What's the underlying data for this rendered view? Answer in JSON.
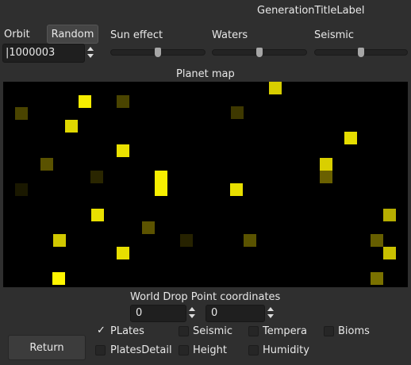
{
  "title": "GenerationTitleLabel",
  "orbit": {
    "label": "Orbit",
    "random_label": "Random",
    "value": "|1000003"
  },
  "sliders": [
    {
      "label": "Sun effect",
      "value": 0.5
    },
    {
      "label": "Waters",
      "value": 0.5
    },
    {
      "label": "Seismic",
      "value": 0.5
    }
  ],
  "map": {
    "label": "Planet map",
    "cells": [
      {
        "c": "#f5ec00"
      },
      {
        "c": "#4a4400"
      },
      {
        "c": "#4a4400"
      },
      {
        "c": "#e0d800"
      },
      {
        "c": "#3e3800"
      },
      {
        "c": "#d7cd00"
      },
      {
        "c": "#e6dd00"
      },
      {
        "c": "#5a5200"
      },
      {
        "c": "#eae100"
      },
      {
        "c": "#2a2600"
      },
      {
        "c": "#f7ef00"
      },
      {
        "c": "#e8df00"
      },
      {
        "c": "#d9cf00"
      },
      {
        "c": "#6a6000"
      },
      {
        "c": "#1a1800"
      },
      {
        "c": "#e9e000"
      },
      {
        "c": "#5c5300"
      },
      {
        "c": "#262200"
      },
      {
        "c": "#5a5300"
      },
      {
        "c": "#b6ad00"
      },
      {
        "c": "#d1c800"
      },
      {
        "c": "#665e00"
      },
      {
        "c": "#e7de00"
      },
      {
        "c": "#c9c000"
      },
      {
        "c": "#7a7100"
      },
      {
        "c": "#fff600"
      },
      {
        "c": "#ded500"
      },
      {
        "c": "#7f7400"
      },
      {
        "c": "#666000"
      },
      {
        "c": "#8a8100"
      }
    ]
  },
  "world_drop": {
    "label": "World Drop Point coordinates",
    "x": "0",
    "y": "0"
  },
  "return_label": "Return",
  "layers": [
    {
      "label": "PLates",
      "checked": true
    },
    {
      "label": "Seismic",
      "checked": false
    },
    {
      "label": "Tempera",
      "checked": false
    },
    {
      "label": "Bioms",
      "checked": false
    },
    {
      "label": "PlatesDetail",
      "checked": false
    },
    {
      "label": "Height",
      "checked": false
    },
    {
      "label": "Humidity",
      "checked": false
    }
  ],
  "check_mark": "✓",
  "icons": {
    "spin_arrows": "spin-up-down-icon",
    "check": "checkmark-icon"
  }
}
